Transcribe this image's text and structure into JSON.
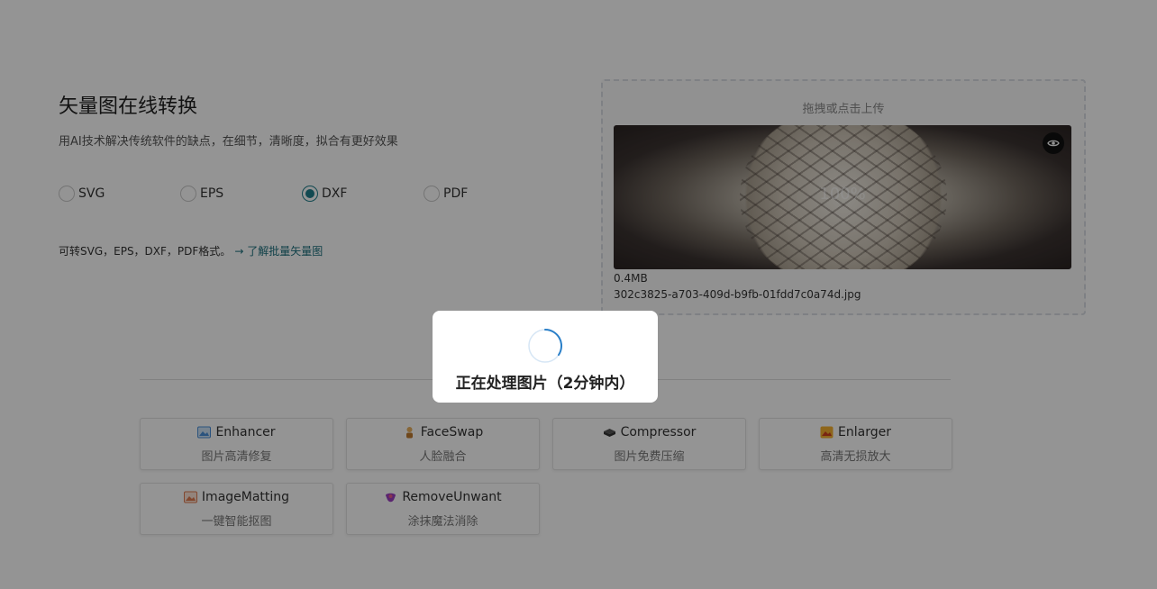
{
  "header": {
    "title": "矢量图在线转换",
    "subtitle": "用AI技术解决传统软件的缺点，在细节，清晰度，拟合有更好效果"
  },
  "formats": [
    {
      "label": "SVG",
      "checked": false
    },
    {
      "label": "EPS",
      "checked": false
    },
    {
      "label": "DXF",
      "checked": true
    },
    {
      "label": "PDF",
      "checked": false
    }
  ],
  "info": {
    "text": "可转SVG，EPS，DXF，PDF格式。",
    "link_arrow": "→",
    "link": "了解批量矢量图"
  },
  "upload": {
    "hint": "拖拽或点击上传",
    "progress": "100%",
    "file_size": "0.4MB",
    "file_name": "302c3825-a703-409d-b9fb-01fdd7c0a74d.jpg"
  },
  "tools": [
    {
      "title": "Enhancer",
      "subtitle": "图片高清修复",
      "icon": "image-icon",
      "color": "#4a90d9"
    },
    {
      "title": "FaceSwap",
      "subtitle": "人脸融合",
      "icon": "person-icon",
      "color": "#e0a040"
    },
    {
      "title": "Compressor",
      "subtitle": "图片免费压缩",
      "icon": "compress-icon",
      "color": "#3b3b3b"
    },
    {
      "title": "Enlarger",
      "subtitle": "高清无损放大",
      "icon": "enlarge-icon",
      "color": "#f0a020"
    },
    {
      "title": "ImageMatting",
      "subtitle": "一键智能抠图",
      "icon": "matting-icon",
      "color": "#e07a50"
    },
    {
      "title": "RemoveUnwant",
      "subtitle": "涂抹魔法消除",
      "icon": "magic-icon",
      "color": "#9b3fc2"
    }
  ],
  "modal": {
    "text": "正在处理图片（2分钟内）"
  },
  "colors": {
    "accent": "#1f7f8c"
  }
}
